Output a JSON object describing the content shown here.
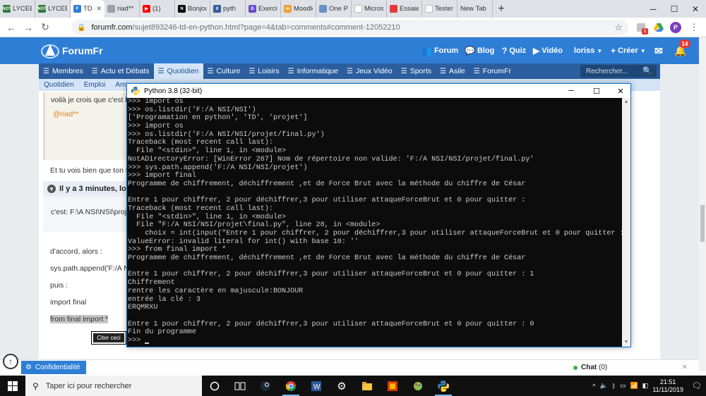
{
  "browser": {
    "tabs": [
      {
        "label": "LYCEE C",
        "fav_color": "#2b7a3d",
        "fav_text": "NOT"
      },
      {
        "label": "LYCEE C",
        "fav_color": "#2b7a3d",
        "fav_text": "NOT"
      },
      {
        "label": "TD e",
        "fav_color": "#2f7ed6",
        "fav_text": "F",
        "active": true
      },
      {
        "label": "riad**",
        "fav_color": "#9aa0a6",
        "fav_text": ""
      },
      {
        "label": "(1)",
        "fav_color": "#ff0000",
        "fav_text": "▶"
      },
      {
        "label": "Bonjou",
        "fav_color": "#000000",
        "fav_text": "N"
      },
      {
        "label": "pyth",
        "fav_color": "#3b5998",
        "fav_text": "II"
      },
      {
        "label": "Exercic",
        "fav_color": "#6a4cc7",
        "fav_text": "D"
      },
      {
        "label": "Moodle",
        "fav_color": "#f0a030",
        "fav_text": "m"
      },
      {
        "label": "One Pie",
        "fav_color": "#6b8fc9",
        "fav_text": ""
      },
      {
        "label": "Microsc",
        "fav_color": "#ffffff",
        "fav_text": ""
      },
      {
        "label": "Essaie d",
        "fav_color": "#e53935",
        "fav_text": ""
      },
      {
        "label": "Tester",
        "fav_color": "#ffffff",
        "fav_text": ""
      },
      {
        "label": "New Tab",
        "fav_color": "",
        "fav_text": ""
      }
    ],
    "url_host": "forumfr.com",
    "url_rest": "/sujet893246-td-en-python.html?page=4&tab=comments#comment-12052210",
    "ext_badge": "1",
    "profile_initial": "P"
  },
  "site": {
    "logo": "ForumFr",
    "nav": {
      "forum": "Forum",
      "blog": "Blog",
      "quiz": "Quiz",
      "video": "Vidéo",
      "user": "loriss",
      "create": "Créer",
      "notif_count": "14"
    },
    "categories": [
      "Membres",
      "Actu et Débats",
      "Quotidien",
      "Culture",
      "Loisirs",
      "Informatique",
      "Jeux Vidéo",
      "Sports",
      "Asile",
      "ForumFr"
    ],
    "search_placeholder": "Rechercher...",
    "subcats": [
      "Quotidien",
      "Emploi",
      "Ami"
    ],
    "post": {
      "quote_line": "voilà je crois que c'est b",
      "mention": "@riad**",
      "reply_text": "Et tu vois bien que ton f",
      "reply_header": "Il y a 3 minutes, lor",
      "reply_quote": "c'est: F:\\A NSI\\NSI\\proje",
      "line1": "d'accord, alors :",
      "line2": "sys.path.append('F:/A N",
      "line3": "puis :",
      "line4": "import final",
      "line5": "from final import *",
      "citer": "Citer ceci"
    },
    "privacy": "Confidentialité",
    "chat_label": "Chat",
    "chat_count": "(0)"
  },
  "console": {
    "title": "Python 3.8 (32-bit)",
    "lines": [
      ">>> import os",
      ">>> os.listdir('F:/A NSI/NSI')",
      "['Programation en python', 'TD', 'projet']",
      ">>> import os",
      ">>> os.listdir('F:/A NSI/NSI/projet/final.py')",
      "Traceback (most recent call last):",
      "  File \"<stdin>\", line 1, in <module>",
      "NotADirectoryError: [WinError 267] Nom de répertoire non valide: 'F:/A NSI/NSI/projet/final.py'",
      ">>> sys.path.append('F:/A NSI/NSI/projet')",
      ">>> import final",
      "Programme de chiffrement, déchiffrement ,et de Force Brut avec la méthode du chiffre de César",
      "",
      "Entre 1 pour chiffrer, 2 pour déchiffrer,3 pour utiliser attaqueForceBrut et 0 pour quitter :",
      "Traceback (most recent call last):",
      "  File \"<stdin>\", line 1, in <module>",
      "  File \"F:/A NSI/NSI/projet\\final.py\", line 28, in <module>",
      "    choix = int(input(\"Entre 1 pour chiffrer, 2 pour déchiffrer,3 pour utiliser attaqueForceBrut et 0 pour quitter : \"))",
      "ValueError: invalid literal for int() with base 10: ''",
      ">>> from final import *",
      "Programme de chiffrement, déchiffrement ,et de Force Brut avec la méthode du chiffre de César",
      "",
      "Entre 1 pour chiffrer, 2 pour déchiffrer,3 pour utiliser attaqueForceBrut et 0 pour quitter : 1",
      "Chiffrement",
      "rentre les caractère en majuscule:BONJOUR",
      "entrée la clé : 3",
      "ERQMRXU",
      "",
      "Entre 1 pour chiffrer, 2 pour déchiffrer,3 pour utiliser attaqueForceBrut et 0 pour quitter : 0",
      "Fin du programme",
      ">>> "
    ]
  },
  "taskbar": {
    "search_placeholder": "Taper ici pour rechercher",
    "time": "21:51",
    "date": "11/11/2019"
  }
}
